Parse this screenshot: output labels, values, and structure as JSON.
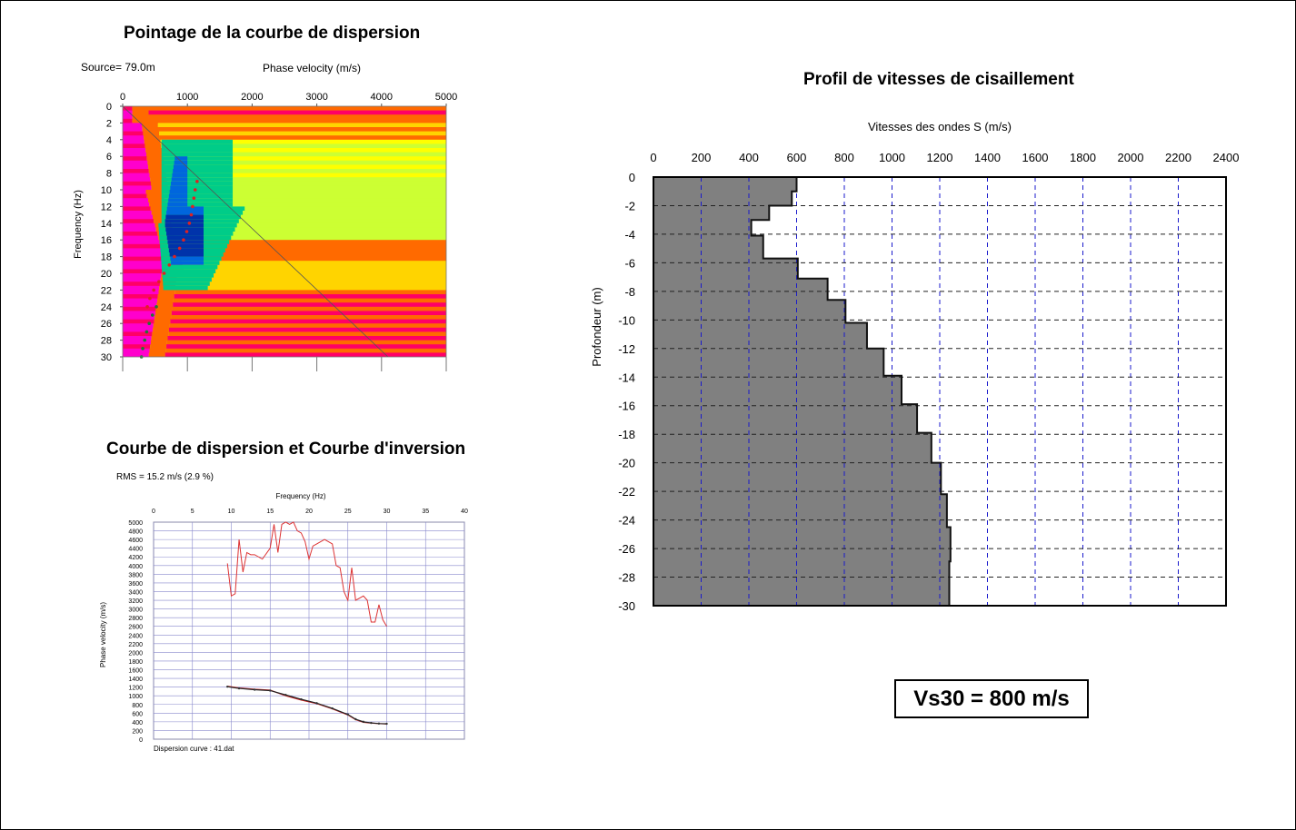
{
  "panels": {
    "picking": {
      "title": "Pointage de la courbe de dispersion",
      "source_label": "Source= 79.0m",
      "x_axis_label": "Phase velocity (m/s)",
      "y_axis_label": "Frequency (Hz)"
    },
    "inversion": {
      "title": "Courbe de dispersion et Courbe d'inversion",
      "rms_label": "RMS = 15.2 m/s (2.9 %)",
      "x_axis_label": "Frequency (Hz)",
      "y_axis_label": "Phase velocity (m/s)",
      "footer_label": "Dispersion curve : 41.dat"
    },
    "profile": {
      "title": "Profil de vitesses de cisaillement",
      "x_axis_label": "Vitesses des ondes S (m/s)",
      "y_axis_label": "Profondeur (m)"
    }
  },
  "vs30_label": "Vs30 = 800 m/s",
  "chart_data": [
    {
      "id": "picking",
      "type": "heatmap",
      "title": "Pointage de la courbe de dispersion",
      "xlabel": "Phase velocity (m/s)",
      "ylabel": "Frequency (Hz)",
      "xlim": [
        0,
        5000
      ],
      "ylim": [
        0,
        30
      ],
      "y_inverted": true,
      "x_ticks": [
        0,
        1000,
        2000,
        3000,
        4000,
        5000
      ],
      "y_ticks": [
        0,
        2,
        4,
        6,
        8,
        10,
        12,
        14,
        16,
        18,
        20,
        22,
        24,
        26,
        28,
        30
      ],
      "colormap": [
        "#ff00cc",
        "#ff0066",
        "#ff6a00",
        "#ffd400",
        "#ffff00",
        "#ccff33",
        "#66ee44",
        "#00cc88",
        "#0066dd",
        "#0033aa"
      ],
      "picked_curve": {
        "name": "",
        "color": "#dd2222",
        "x": [
          1150,
          1120,
          1100,
          1080,
          1060,
          1030,
          990,
          940,
          880,
          800,
          720,
          640,
          560,
          480,
          420,
          380
        ],
        "y": [
          9,
          10,
          11,
          12,
          13,
          14,
          15,
          16,
          17,
          18,
          19,
          20,
          21,
          22,
          23,
          24
        ]
      },
      "picked_curve_low": {
        "name": "",
        "color": "#227733",
        "x": [
          520,
          460,
          410,
          370,
          340,
          310,
          290
        ],
        "y": [
          24,
          25,
          26,
          27,
          28,
          29,
          30
        ]
      }
    },
    {
      "id": "inversion",
      "type": "line",
      "title": "Courbe de dispersion et Courbe d'inversion",
      "xlabel": "Frequency (Hz)",
      "ylabel": "Phase velocity (m/s)",
      "xlim": [
        0,
        40
      ],
      "ylim": [
        0,
        5000
      ],
      "x_ticks": [
        0,
        5,
        10,
        15,
        20,
        25,
        30,
        35,
        40
      ],
      "y_ticks": [
        0,
        200,
        400,
        600,
        800,
        1000,
        1200,
        1400,
        1600,
        1800,
        2000,
        2200,
        2400,
        2600,
        2800,
        3000,
        3200,
        3400,
        3600,
        3800,
        4000,
        4200,
        4400,
        4600,
        4800,
        5000
      ],
      "series": [
        {
          "name": "",
          "color": "#dd3333",
          "x": [
            9.5,
            10,
            10.5,
            11,
            11.5,
            12,
            12.5,
            13,
            14,
            15,
            15.5,
            16,
            16.5,
            17,
            17.5,
            18,
            18.5,
            19,
            19.5,
            20,
            20.5,
            21,
            22,
            23,
            23.5,
            24,
            24.5,
            25,
            25.5,
            26,
            26.5,
            27,
            27.5,
            28,
            28.5,
            29,
            29.5,
            30
          ],
          "y": [
            4050,
            3300,
            3350,
            4600,
            3850,
            4300,
            4250,
            4250,
            4150,
            4400,
            4950,
            4300,
            4950,
            5000,
            4950,
            5000,
            4800,
            4750,
            4550,
            4150,
            4450,
            4500,
            4600,
            4500,
            4000,
            3950,
            3400,
            3200,
            3950,
            3200,
            3250,
            3300,
            3200,
            2700,
            2700,
            3100,
            2750,
            2600
          ]
        },
        {
          "name": "",
          "color": "#cc2222",
          "x": [
            9.5,
            11,
            13,
            15,
            17,
            19,
            21,
            23,
            25,
            26,
            27,
            28,
            29,
            30
          ],
          "y": [
            1220,
            1180,
            1150,
            1130,
            1000,
            900,
            820,
            700,
            560,
            450,
            390,
            370,
            360,
            350
          ]
        },
        {
          "name": "",
          "color": "#222222",
          "x": [
            9.5,
            11,
            13,
            15,
            17,
            19,
            21,
            23,
            25,
            26,
            27,
            28,
            29,
            30
          ],
          "y": [
            1210,
            1170,
            1140,
            1120,
            1020,
            920,
            830,
            710,
            570,
            460,
            400,
            375,
            360,
            355
          ]
        }
      ]
    },
    {
      "id": "profile",
      "type": "area",
      "title": "Profil de vitesses de cisaillement",
      "xlabel": "Vitesses des ondes S (m/s)",
      "ylabel": "Profondeur (m)",
      "xlim": [
        0,
        2400
      ],
      "ylim": [
        -30,
        0
      ],
      "x_ticks": [
        0,
        200,
        400,
        600,
        800,
        1000,
        1200,
        1400,
        1600,
        1800,
        2000,
        2200,
        2400
      ],
      "y_ticks": [
        0,
        -2,
        -4,
        -6,
        -8,
        -10,
        -12,
        -14,
        -16,
        -18,
        -20,
        -22,
        -24,
        -26,
        -28,
        -30
      ],
      "grid": true,
      "layers": [
        {
          "top": 0,
          "bottom": -1,
          "vs": 600
        },
        {
          "top": -1,
          "bottom": -2,
          "vs": 580
        },
        {
          "top": -2,
          "bottom": -3,
          "vs": 485
        },
        {
          "top": -3,
          "bottom": -4.1,
          "vs": 410
        },
        {
          "top": -4.1,
          "bottom": -5.7,
          "vs": 460
        },
        {
          "top": -5.7,
          "bottom": -7.1,
          "vs": 605
        },
        {
          "top": -7.1,
          "bottom": -8.6,
          "vs": 730
        },
        {
          "top": -8.6,
          "bottom": -10.2,
          "vs": 805
        },
        {
          "top": -10.2,
          "bottom": -12,
          "vs": 895
        },
        {
          "top": -12,
          "bottom": -13.9,
          "vs": 965
        },
        {
          "top": -13.9,
          "bottom": -15.9,
          "vs": 1040
        },
        {
          "top": -15.9,
          "bottom": -17.9,
          "vs": 1105
        },
        {
          "top": -17.9,
          "bottom": -20,
          "vs": 1165
        },
        {
          "top": -20,
          "bottom": -22.2,
          "vs": 1205
        },
        {
          "top": -22.2,
          "bottom": -24.5,
          "vs": 1230
        },
        {
          "top": -24.5,
          "bottom": -26.9,
          "vs": 1245
        },
        {
          "top": -26.9,
          "bottom": -30,
          "vs": 1240
        }
      ]
    }
  ]
}
